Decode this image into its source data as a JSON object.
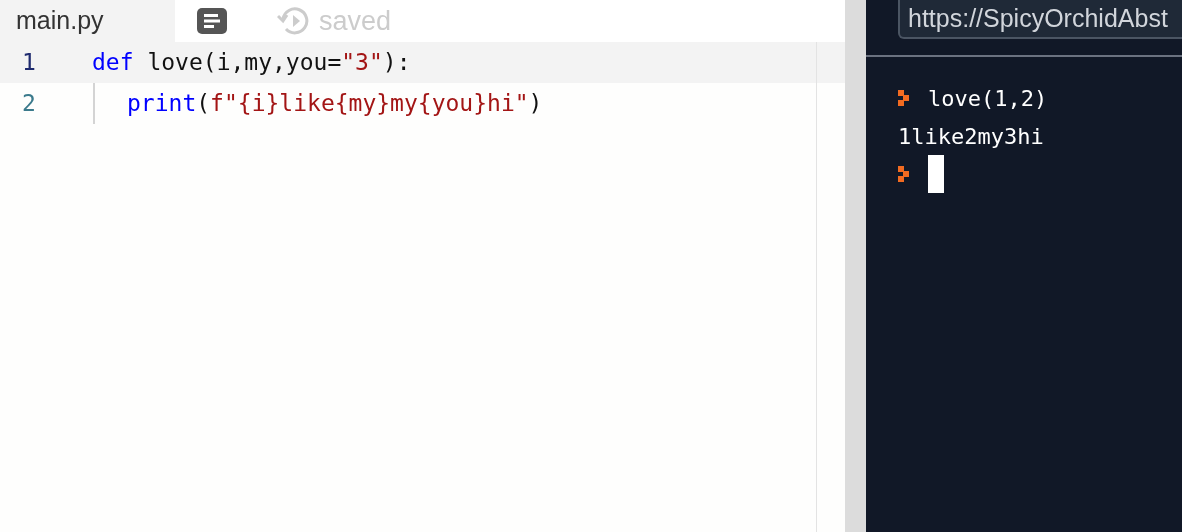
{
  "tabs": [
    {
      "kind": "file",
      "label": "main.py",
      "selected": true
    },
    {
      "kind": "format"
    },
    {
      "kind": "history",
      "label": "saved"
    }
  ],
  "editor": {
    "lines": [
      {
        "number": "1",
        "active": true,
        "indent": false,
        "tokens": [
          {
            "kind": "keyword",
            "text": "def"
          },
          {
            "kind": "plain",
            "text": " love(i,my,you="
          },
          {
            "kind": "string",
            "text": "\"3\""
          },
          {
            "kind": "plain",
            "text": "):"
          }
        ]
      },
      {
        "number": "2",
        "active": false,
        "indent": true,
        "tokens": [
          {
            "kind": "keyword",
            "text": "print"
          },
          {
            "kind": "plain",
            "text": "("
          },
          {
            "kind": "string",
            "text": "f\"{i}like{my}my{you}hi\""
          },
          {
            "kind": "plain",
            "text": ")"
          }
        ]
      }
    ]
  },
  "console": {
    "url": "https://SpicyOrchidAbst",
    "lines": [
      {
        "kind": "input",
        "text": "love(1,2)"
      },
      {
        "kind": "output",
        "text": "1like2my3hi"
      },
      {
        "kind": "prompt"
      }
    ]
  }
}
